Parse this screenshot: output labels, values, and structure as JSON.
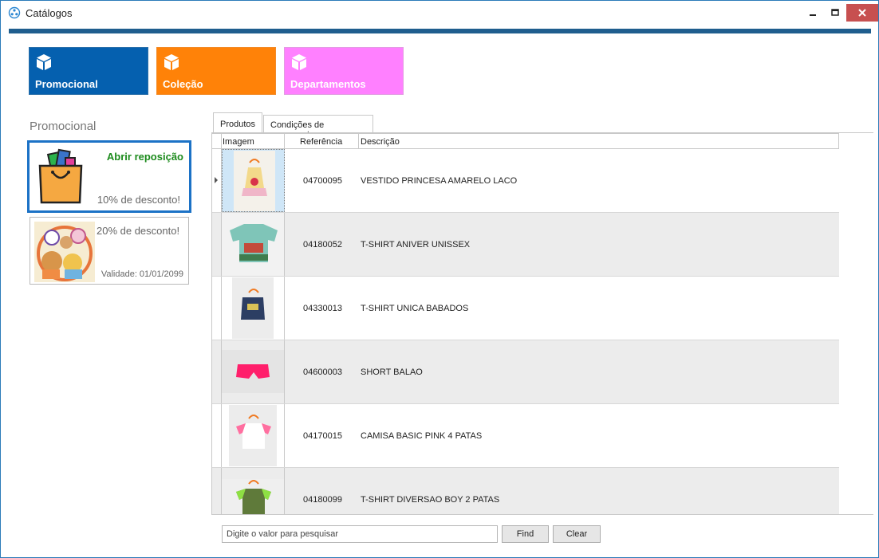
{
  "window": {
    "title": "Catálogos"
  },
  "tiles": [
    {
      "label": "Promocional",
      "color": "#0560af"
    },
    {
      "label": "Coleção",
      "color": "#ff8208"
    },
    {
      "label": "Departamentos",
      "color": "#ff80ff"
    }
  ],
  "promotions": {
    "section_title": "Promocional",
    "cards": [
      {
        "headline": "Abrir reposição",
        "discount": "10% de desconto!",
        "validity": ""
      },
      {
        "headline": "",
        "discount": "20% de desconto!",
        "validity": "Validade: 01/01/2099"
      }
    ]
  },
  "tabs": [
    {
      "label": "Produtos",
      "active": true
    },
    {
      "label": "Condições de pagamento",
      "active": false
    }
  ],
  "grid": {
    "columns": [
      "Imagem",
      "Referência",
      "Descrição"
    ],
    "rows": [
      {
        "ref": "04700095",
        "desc": "VESTIDO PRINCESA AMARELO LACO",
        "image": "dress-yellow"
      },
      {
        "ref": "04180052",
        "desc": "T-SHIRT ANIVER UNISSEX",
        "image": "tshirt-green"
      },
      {
        "ref": "04330013",
        "desc": "T-SHIRT UNICA BABADOS",
        "image": "tshirt-navy"
      },
      {
        "ref": "04600003",
        "desc": "SHORT BALAO",
        "image": "shorts-pink"
      },
      {
        "ref": "04170015",
        "desc": "CAMISA BASIC PINK 4 PATAS",
        "image": "shirt-white-pink"
      },
      {
        "ref": "04180099",
        "desc": "T-SHIRT DIVERSAO BOY 2 PATAS",
        "image": "tshirt-camo"
      }
    ]
  },
  "search": {
    "placeholder": "Digite o valor para pesquisar",
    "find_label": "Find",
    "clear_label": "Clear"
  }
}
